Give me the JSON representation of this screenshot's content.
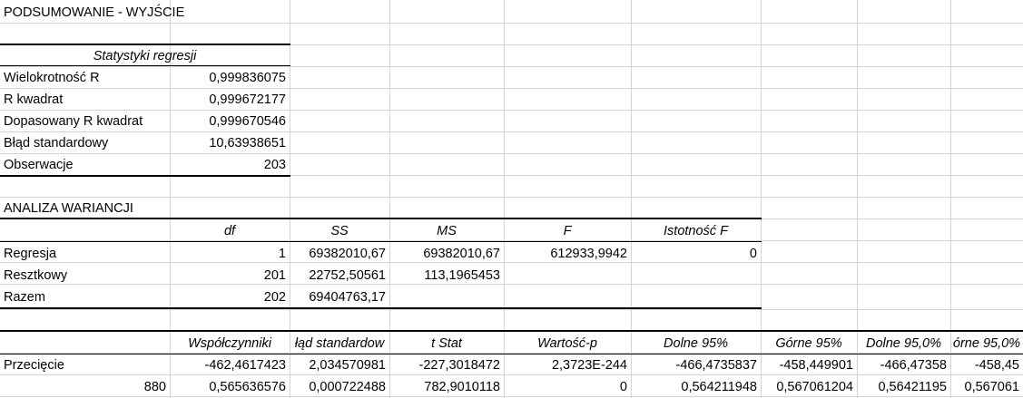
{
  "title": "PODSUMOWANIE - WYJŚCIE",
  "regression_stats": {
    "header": "Statystyki regresji",
    "rows": [
      {
        "label": "Wielokrotność R",
        "value": "0,999836075"
      },
      {
        "label": "R kwadrat",
        "value": "0,999672177"
      },
      {
        "label": "Dopasowany R kwadrat",
        "value": "0,999670546"
      },
      {
        "label": "Błąd standardowy",
        "value": "10,63938651"
      },
      {
        "label": "Obserwacje",
        "value": "203"
      }
    ]
  },
  "anova": {
    "title": "ANALIZA WARIANCJI",
    "headers": [
      "df",
      "SS",
      "MS",
      "F",
      "Istotność F"
    ],
    "rows": [
      {
        "label": "Regresja",
        "df": "1",
        "ss": "69382010,67",
        "ms": "69382010,67",
        "f": "612933,9942",
        "sig": "0"
      },
      {
        "label": "Resztkowy",
        "df": "201",
        "ss": "22752,50561",
        "ms": "113,1965453",
        "f": "",
        "sig": ""
      },
      {
        "label": "Razem",
        "df": "202",
        "ss": "69404763,17",
        "ms": "",
        "f": "",
        "sig": ""
      }
    ]
  },
  "coefficients": {
    "headers": [
      "Współczynniki",
      "łąd standardow",
      "t Stat",
      "Wartość-p",
      "Dolne 95%",
      "Górne 95%",
      "Dolne 95,0%",
      "órne 95,0%"
    ],
    "rows": [
      {
        "label": "Przecięcie",
        "values": [
          "-462,4617423",
          "2,034570981",
          "-227,3018472",
          "2,3723E-244",
          "-466,4735837",
          "-458,449901",
          "-466,47358",
          "-458,45"
        ]
      },
      {
        "label": "880",
        "values": [
          "0,565636576",
          "0,000722488",
          "782,9010118",
          "0",
          "0,564211948",
          "0,567061204",
          "0,56421195",
          "0,567061"
        ]
      }
    ]
  }
}
